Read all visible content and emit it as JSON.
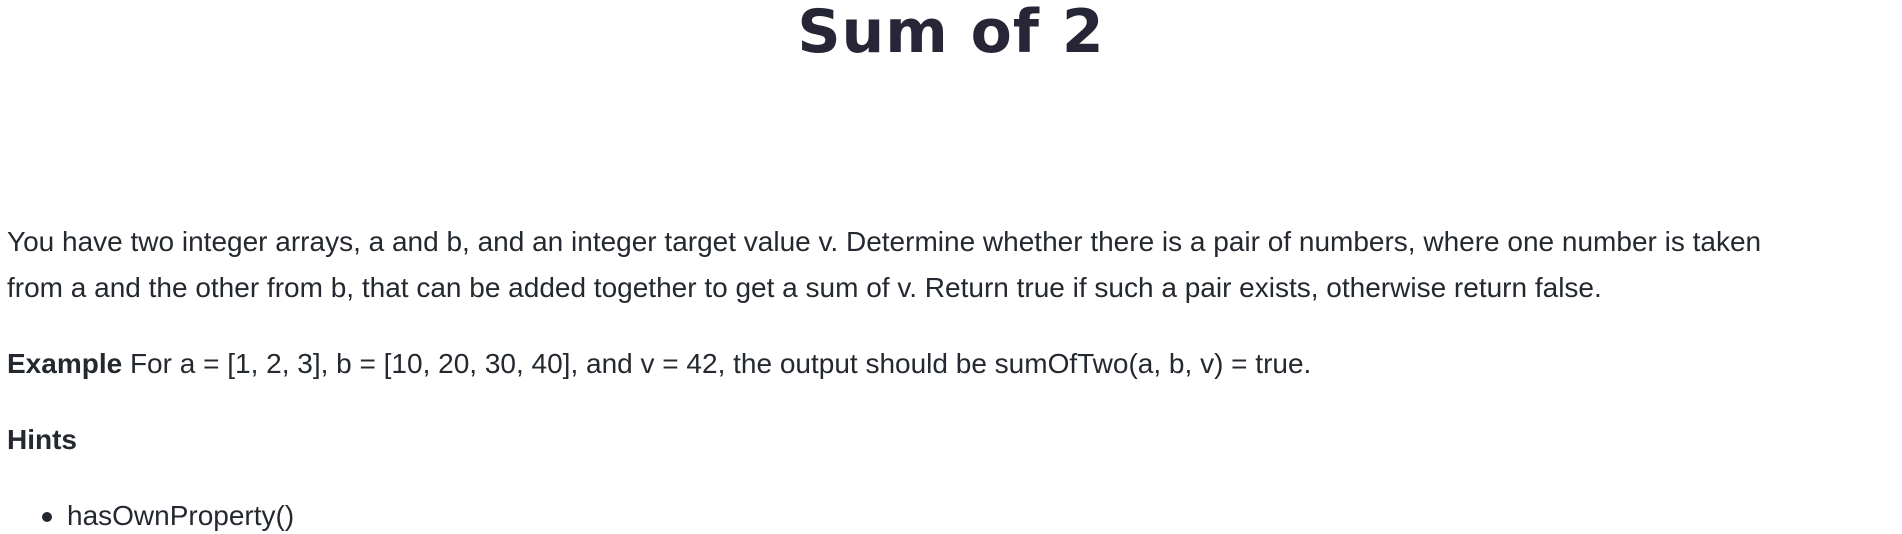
{
  "title": "Sum of 2",
  "description": {
    "line1": "You have two integer arrays, a and b, and an integer target value v. Determine whether there is a pair of numbers, where one number is taken",
    "line2": "from a and the other from b, that can be added together to get a sum of v. Return true if such a pair exists, otherwise return false."
  },
  "example": {
    "label": "Example",
    "text": " For a = [1, 2, 3], b = [10, 20, 30, 40], and v = 42, the output should be sumOfTwo(a, b, v) = true."
  },
  "hints": {
    "heading": "Hints",
    "items": [
      "hasOwnProperty()"
    ]
  }
}
